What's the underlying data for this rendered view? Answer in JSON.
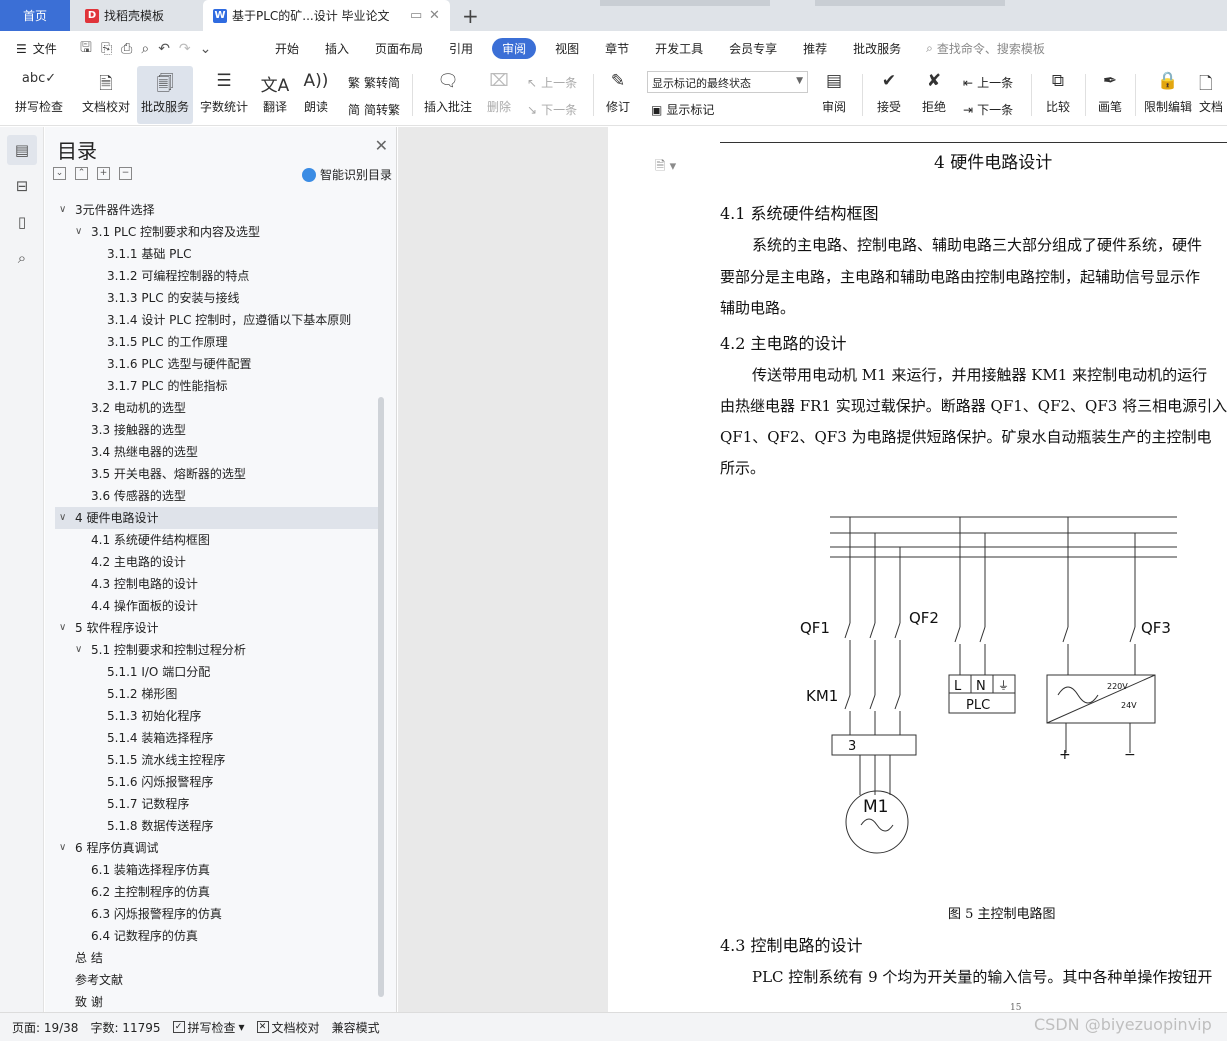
{
  "tabs": {
    "home": "首页",
    "template": "找稻壳模板",
    "document": "基于PLC的矿...设计 毕业论文",
    "add": "+"
  },
  "menu": {
    "file": "文件",
    "items": [
      "开始",
      "插入",
      "页面布局",
      "引用",
      "审阅",
      "视图",
      "章节",
      "开发工具",
      "会员专享",
      "推荐",
      "批改服务"
    ],
    "active": "审阅",
    "search_placeholder": "查找命令、搜索模板"
  },
  "toolbar": {
    "spellcheck": "拼写检查",
    "proofread": "文档校对",
    "correct_service": "批改服务",
    "word_count": "字数统计",
    "translate": "翻译",
    "read_aloud": "朗读",
    "trad_conv": "繁转简",
    "simp_conv": "简转繁",
    "insert_comment": "插入批注",
    "delete": "删除",
    "prev": "上一条",
    "next": "下一条",
    "revise": "修订",
    "markup_select": "显示标记的最终状态",
    "show_markup": "显示标记",
    "review": "审阅",
    "accept": "接受",
    "reject": "拒绝",
    "prev2": "上一条",
    "next2": "下一条",
    "compare": "比较",
    "pen": "画笔",
    "restrict": "限制编辑",
    "doc_rights": "文档"
  },
  "toc": {
    "title": "目录",
    "ai_button": "智能识别目录",
    "items": [
      {
        "text": "3元件器件选择",
        "level": 1,
        "caret": "v"
      },
      {
        "text": "3.1 PLC 控制要求和内容及选型",
        "level": 2,
        "caret": "v"
      },
      {
        "text": "3.1.1 基础 PLC",
        "level": 3
      },
      {
        "text": "3.1.2 可编程控制器的特点",
        "level": 3
      },
      {
        "text": "3.1.3 PLC 的安装与接线",
        "level": 3
      },
      {
        "text": "3.1.4 设计 PLC 控制时，应遵循以下基本原则",
        "level": 3
      },
      {
        "text": "3.1.5 PLC 的工作原理",
        "level": 3
      },
      {
        "text": "3.1.6 PLC 选型与硬件配置",
        "level": 3
      },
      {
        "text": "3.1.7 PLC 的性能指标",
        "level": 3
      },
      {
        "text": "3.2 电动机的选型",
        "level": 2
      },
      {
        "text": "3.3 接触器的选型",
        "level": 2
      },
      {
        "text": "3.4 热继电器的选型",
        "level": 2
      },
      {
        "text": "3.5 开关电器、熔断器的选型",
        "level": 2
      },
      {
        "text": "3.6 传感器的选型",
        "level": 2
      },
      {
        "text": "4  硬件电路设计",
        "level": 1,
        "caret": "v",
        "highlight": true
      },
      {
        "text": "4.1 系统硬件结构框图",
        "level": 2
      },
      {
        "text": "4.2 主电路的设计",
        "level": 2
      },
      {
        "text": "4.3 控制电路的设计",
        "level": 2
      },
      {
        "text": "4.4 操作面板的设计",
        "level": 2
      },
      {
        "text": "5  软件程序设计",
        "level": 1,
        "caret": "v"
      },
      {
        "text": "5.1 控制要求和控制过程分析",
        "level": 2,
        "caret": "v"
      },
      {
        "text": "5.1.1 I/O 端口分配",
        "level": 3
      },
      {
        "text": "5.1.2 梯形图",
        "level": 3
      },
      {
        "text": "5.1.3 初始化程序",
        "level": 3
      },
      {
        "text": "5.1.4 装箱选择程序",
        "level": 3
      },
      {
        "text": "5.1.5 流水线主控程序",
        "level": 3
      },
      {
        "text": "5.1.6 闪烁报警程序",
        "level": 3
      },
      {
        "text": "5.1.7 记数程序",
        "level": 3
      },
      {
        "text": "5.1.8 数据传送程序",
        "level": 3
      },
      {
        "text": "6  程序仿真调试",
        "level": 1,
        "caret": "v"
      },
      {
        "text": "6.1 装箱选择程序仿真",
        "level": 2
      },
      {
        "text": "6.2 主控制程序的仿真",
        "level": 2
      },
      {
        "text": "6.3 闪烁报警程序的仿真",
        "level": 2
      },
      {
        "text": "6.4 记数程序的仿真",
        "level": 2
      },
      {
        "text": "总  结",
        "level": 1
      },
      {
        "text": "参考文献",
        "level": 1
      },
      {
        "text": "致  谢",
        "level": 1
      }
    ]
  },
  "document": {
    "chapter": "4  硬件电路设计",
    "s41_title": "4.1 系统硬件结构框图",
    "s41_p1": "系统的主电路、控制电路、辅助电路三大部分组成了硬件系统，硬件",
    "s41_p2": "要部分是主电路，主电路和辅助电路由控制电路控制，起辅助信号显示作",
    "s41_p3": "辅助电路。",
    "s42_title": "4.2 主电路的设计",
    "s42_p1": "传送带用电动机 M1 来运行，并用接触器 KM1 来控制电动机的运行",
    "s42_p2": "由热继电器 FR1 实现过载保护。断路器 QF1、QF2、QF3 将三相电源引入",
    "s42_p3": "QF1、QF2、QF3 为电路提供短路保护。矿泉水自动瓶装生产的主控制电",
    "s42_p4": "所示。",
    "caption": "图 5 主控制电路图",
    "s43_title": "4.3 控制电路的设计",
    "s43_p1": "PLC 控制系统有 9 个均为开关量的输入信号。其中各种单操作按钮开",
    "page_number": "15",
    "circuit": {
      "qf1": "QF1",
      "qf2": "QF2",
      "qf3": "QF3",
      "km1": "KM1",
      "plc": "PLC",
      "l": "L",
      "n": "N",
      "relay": "3",
      "motor": "M1",
      "v220": "220V",
      "v24": "24V",
      "plus": "+",
      "minus": "−"
    }
  },
  "status": {
    "page": "页面: 19/38",
    "words": "字数: 11795",
    "spell": "拼写检查",
    "proof": "文档校对",
    "compat": "兼容模式",
    "watermark": "CSDN @biyezuopinvip"
  },
  "colors": {
    "accent": "#3b6fd6",
    "tabbar": "#dfe3e8"
  }
}
